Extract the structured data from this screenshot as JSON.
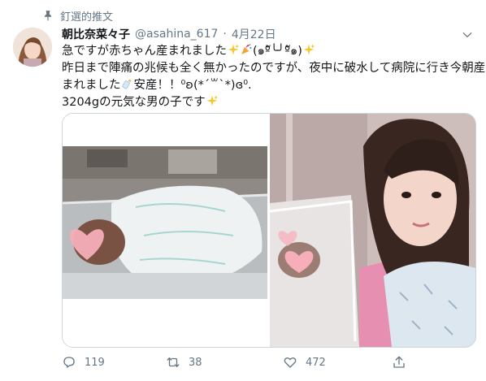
{
  "pinned": {
    "label": "釘選的推文",
    "icon": "pin-icon"
  },
  "author": {
    "name": "朝比奈菜々子",
    "handle": "@asahina_617",
    "separator": "·",
    "date": "4月22日",
    "avatar_icon": "avatar"
  },
  "tweet": {
    "line1_text": "急ですが赤ちゃん産まれました",
    "line1_face": "(๑ºั╰╯ºั๑)",
    "line2": "昨日まで陣痛の兆候も全く無かったのですが、夜中に破水して病院に行き今朝産",
    "line3_a": "まれました",
    "line3_b": "安産！！⁰ʚ(*´꒳`*)ɞ⁰.",
    "line4": "3204gの元気な男の子です"
  },
  "media": {
    "left_photo": "newborn-photo",
    "right_photo": "mother-newborn-photo"
  },
  "actions": {
    "reply_count": "119",
    "retweet_count": "38",
    "like_count": "472"
  },
  "colors": {
    "text": "#14171a",
    "secondary": "#657786",
    "border": "#ccd6dd",
    "sparkle": "#f7c52a"
  }
}
